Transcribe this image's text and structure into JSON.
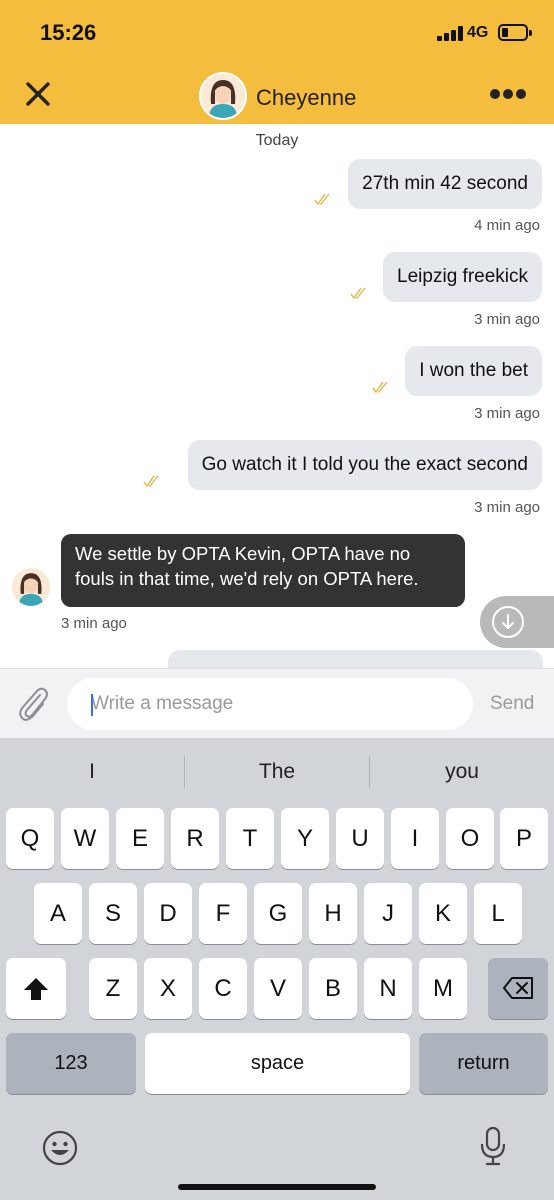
{
  "status_bar": {
    "time": "15:26",
    "network": "4G"
  },
  "header": {
    "contact_name": "Cheyenne",
    "close_icon": "close-icon",
    "more_icon": "more-horizontal-icon",
    "accent_color": "#f5bd3d"
  },
  "chat": {
    "date_separator": "Today",
    "outgoing": [
      {
        "text": "27th min 42 second",
        "time": "4 min ago"
      },
      {
        "text": "Leipzig freekick",
        "time": "3 min ago"
      },
      {
        "text": "I won the bet",
        "time": "3 min ago"
      },
      {
        "text": "Go watch it I told you the exact second",
        "time": "3 min ago"
      }
    ],
    "incoming": {
      "line1": "We settle by OPTA Kevin, OPTA have no",
      "line2": "fouls in that time, we'd rely on OPTA here.",
      "time": "3 min ago"
    },
    "tick_color": "#e3b23c"
  },
  "composer": {
    "placeholder": "Write a message",
    "value": "",
    "send_label": "Send"
  },
  "keyboard": {
    "suggestions": [
      "I",
      "The",
      "you"
    ],
    "row1": [
      "Q",
      "W",
      "E",
      "R",
      "T",
      "Y",
      "U",
      "I",
      "O",
      "P"
    ],
    "row2": [
      "A",
      "S",
      "D",
      "F",
      "G",
      "H",
      "J",
      "K",
      "L"
    ],
    "row3": [
      "Z",
      "X",
      "C",
      "V",
      "B",
      "N",
      "M"
    ],
    "numbers_label": "123",
    "space_label": "space",
    "return_label": "return"
  }
}
